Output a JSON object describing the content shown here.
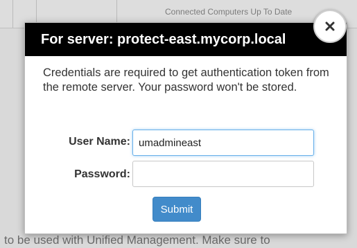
{
  "background": {
    "table_header": "Connected Computers Up To Date",
    "bottom_text": "to be used with Unified Management. Make sure to"
  },
  "dialog": {
    "title": "For server: protect-east.mycorp.local",
    "close_icon": "close-icon",
    "message": "Credentials are required to get authentication token from the remote server. Your password won't be stored.",
    "username": {
      "label": "User Name:",
      "value": "umadmineast"
    },
    "password": {
      "label": "Password:",
      "value": ""
    },
    "submit_label": "Submit"
  },
  "colors": {
    "header_bg": "#000000",
    "submit_bg": "#428bca",
    "focus_border": "#66afe9"
  }
}
